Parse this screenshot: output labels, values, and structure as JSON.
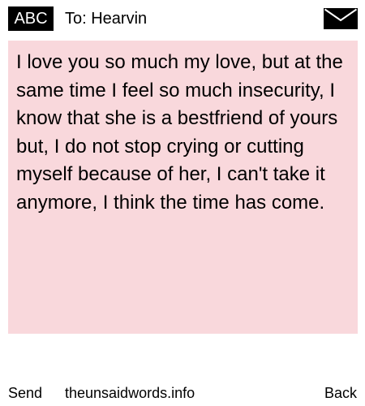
{
  "header": {
    "badge_label": "ABC",
    "to_line": "To: Hearvin",
    "icon": "envelope-icon"
  },
  "message": {
    "body": "I love you so much my love, but at the same time I feel so much insecurity, I know that she is a bestfriend of yours but, I do not stop crying or cutting myself because of her, I can't take it anymore, I think the time has come.",
    "background_color": "#f9d8dc"
  },
  "footer": {
    "send_label": "Send",
    "site_label": "theunsaidwords.info",
    "back_label": "Back"
  }
}
